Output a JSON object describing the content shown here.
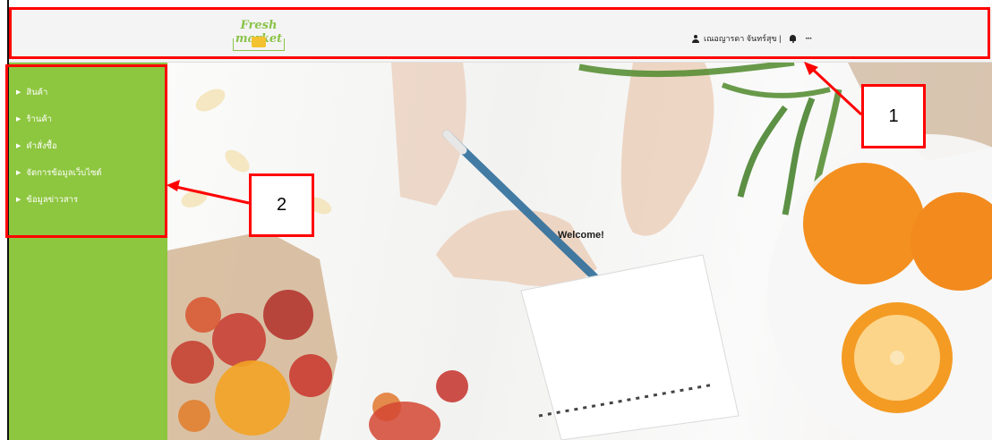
{
  "header": {
    "logo_text": "Fresh market",
    "user_name": "เณอญารดา จันทร์สุข |",
    "user_icon": "user-icon",
    "bell_icon": "bell-icon",
    "more_icon": "more-horizontal-icon",
    "more_glyph": "···"
  },
  "sidebar": {
    "color": "#8dc63f",
    "items": [
      {
        "label": "สินค้า"
      },
      {
        "label": "ร้านค้า"
      },
      {
        "label": "คำสั่งซื้อ"
      },
      {
        "label": "จัดการข้อมูลเว็บไซต์"
      },
      {
        "label": "ข้อมูลข่าวสาร"
      }
    ]
  },
  "main": {
    "welcome": "Welcome!"
  },
  "annotations": {
    "color": "#ff0000",
    "callout_1": "1",
    "callout_2": "2"
  }
}
